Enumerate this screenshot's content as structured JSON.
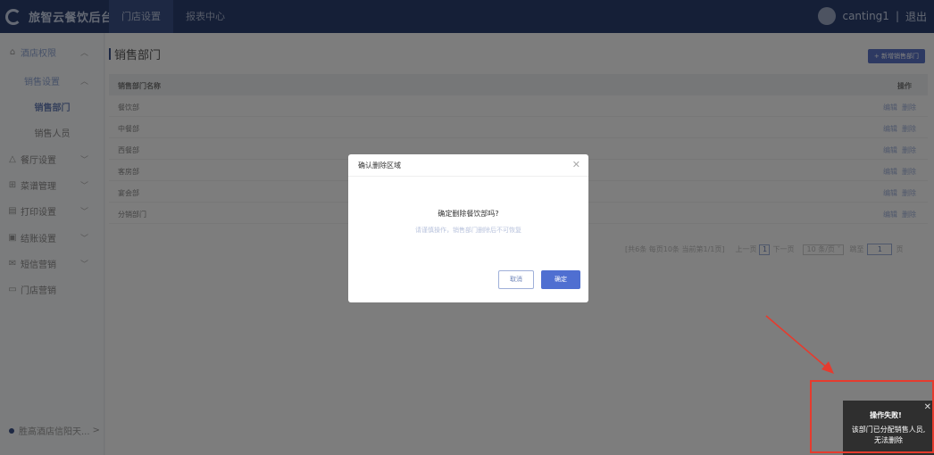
{
  "app": {
    "title": "旅智云餐饮后台"
  },
  "nav": [
    {
      "label": "门店设置"
    },
    {
      "label": "报表中心"
    }
  ],
  "user": {
    "name": "canting1",
    "separator": "|",
    "logout": "退出"
  },
  "sidebar": {
    "items": [
      {
        "label": "酒店权限",
        "icon": "shop-icon"
      },
      {
        "label": "销售设置"
      },
      {
        "label": "销售部门"
      },
      {
        "label": "销售人员"
      },
      {
        "label": "餐厅设置",
        "icon": "house-icon"
      },
      {
        "label": "菜谱管理",
        "icon": "grid-icon"
      },
      {
        "label": "打印设置",
        "icon": "printer-icon"
      },
      {
        "label": "结账设置",
        "icon": "invoice-icon"
      },
      {
        "label": "短信营销",
        "icon": "message-icon"
      },
      {
        "label": "门店营销",
        "icon": "coupon-icon"
      }
    ],
    "footer": "胜高酒店信阳天...",
    "footer_arrow": ">"
  },
  "page": {
    "title": "销售部门",
    "add_button": "+ 新增销售部门"
  },
  "table": {
    "columns": [
      "销售部门名称",
      "操作"
    ],
    "rows": [
      {
        "name": "餐饮部"
      },
      {
        "name": "中餐部"
      },
      {
        "name": "西餐部"
      },
      {
        "name": "客房部"
      },
      {
        "name": "宴会部"
      },
      {
        "name": "分销部门"
      }
    ],
    "action_edit": "编辑",
    "action_delete": "删除"
  },
  "pagination": {
    "info": "[共6条 每页10条 当前第1/1页]",
    "prev": "上一页",
    "current_page": "1",
    "next": "下一页",
    "page_size": "10 条/页",
    "goto_label": "跳至",
    "goto_value": "1",
    "page_unit": "页"
  },
  "modal": {
    "title": "确认删除区域",
    "question": "确定删除餐饮部吗?",
    "hint": "请谨慎操作，销售部门删除后不可恢复",
    "cancel": "取消",
    "confirm": "确定"
  },
  "toast": {
    "title": "操作失败!",
    "line1": "该部门已分配销售人员,",
    "line2": "无法删除"
  },
  "colors": {
    "topbar": "#2a3f6e",
    "primary": "#4f6fd1",
    "annotation": "#e63b2e"
  }
}
